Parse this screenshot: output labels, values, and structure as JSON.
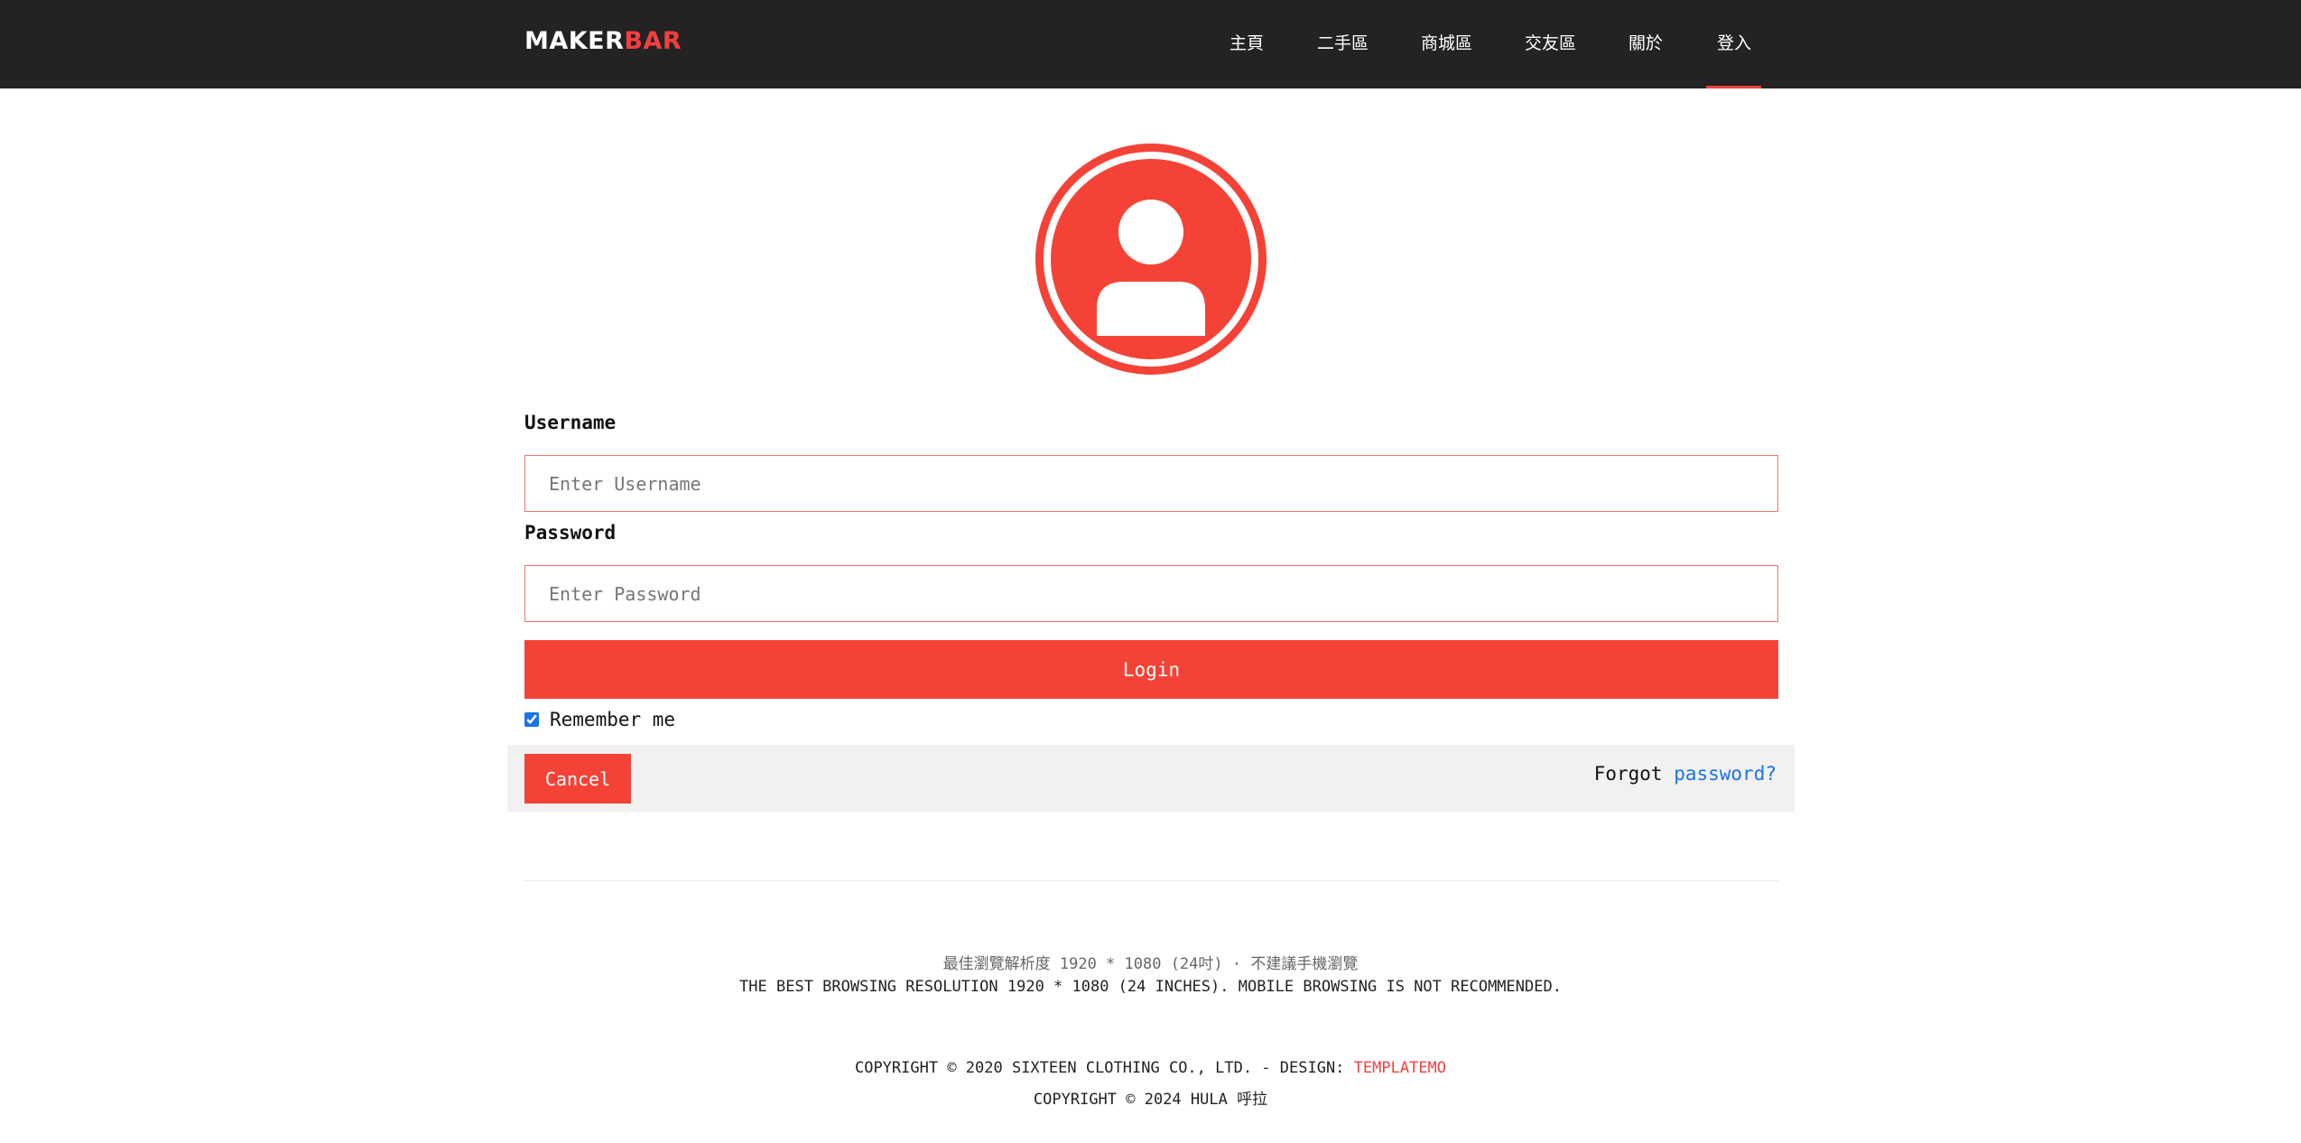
{
  "header": {
    "brand_part1": "MAKER",
    "brand_part2": "BAR",
    "nav": [
      {
        "label": "主頁"
      },
      {
        "label": "二手區"
      },
      {
        "label": "商城區"
      },
      {
        "label": "交友區"
      },
      {
        "label": "關於"
      },
      {
        "label": "登入",
        "active": true
      }
    ]
  },
  "avatar": {
    "icon": "user-circle-icon",
    "color": "#f44336"
  },
  "form": {
    "username_label": "Username",
    "username_placeholder": "Enter Username",
    "password_label": "Password",
    "password_placeholder": "Enter Password",
    "login_label": "Login",
    "remember_label": "Remember me",
    "remember_checked": true,
    "cancel_label": "Cancel",
    "forgot_text": "Forgot",
    "forgot_link": "password?"
  },
  "footer": {
    "resolution_cn": "最佳瀏覽解析度 1920 * 1080 (24吋) · 不建議手機瀏覽",
    "resolution_en": "THE BEST BROWSING RESOLUTION 1920 * 1080 (24 INCHES). MOBILE BROWSING IS NOT RECOMMENDED.",
    "copyright1_prefix": "COPYRIGHT © 2020 SIXTEEN CLOTHING CO., LTD. - DESIGN:",
    "copyright1_link": "TEMPLATEMO",
    "copyright2": "COPYRIGHT © 2024 HULA 呼拉"
  },
  "colors": {
    "accent": "#f44336",
    "navbar": "#232323",
    "link": "#1a73e8",
    "bottom_bar": "#f1f1f1"
  }
}
